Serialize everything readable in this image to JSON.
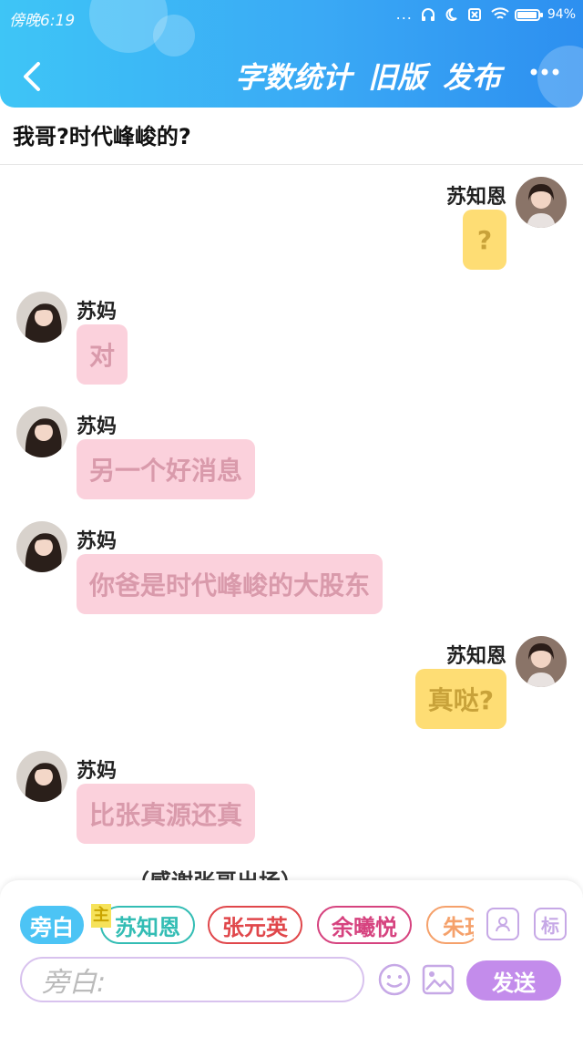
{
  "status_bar": {
    "time": "傍晚6:19",
    "more_dots": "...",
    "battery": "94%"
  },
  "nav": {
    "word_count": "字数统计",
    "old_version": "旧版",
    "publish": "发布",
    "more": "···"
  },
  "chat_title": "我哥?时代峰峻的?",
  "messages": [
    {
      "side": "right",
      "name": "苏知恩",
      "text": "?",
      "color": "yellow"
    },
    {
      "side": "left",
      "name": "苏妈",
      "text": "对",
      "color": "pink"
    },
    {
      "side": "left",
      "name": "苏妈",
      "text": "另一个好消息",
      "color": "pink"
    },
    {
      "side": "left",
      "name": "苏妈",
      "text": "你爸是时代峰峻的大股东",
      "color": "pink"
    },
    {
      "side": "right",
      "name": "苏知恩",
      "text": "真哒?",
      "color": "yellow"
    },
    {
      "side": "left",
      "name": "苏妈",
      "text": "比张真源还真",
      "color": "pink"
    }
  ],
  "narration": "（感谢张哥出场）",
  "composer": {
    "main_tag": "主",
    "roles": [
      {
        "label": "旁白",
        "color": "#4cc4f5",
        "active": true
      },
      {
        "label": "苏知恩",
        "color": "#33bdb4",
        "active": false
      },
      {
        "label": "张元英",
        "color": "#e0474b",
        "active": false
      },
      {
        "label": "余曦悦",
        "color": "#d6437f",
        "active": false
      },
      {
        "label": "朱珏",
        "color": "#f5a16b",
        "active": false
      }
    ],
    "tag_button": "标",
    "input_placeholder": "旁白:",
    "send_label": "发送"
  },
  "colors": {
    "header_start": "#3ec5f6",
    "header_end": "#2d8ff0",
    "pink_bubble": "#fbd1dc",
    "yellow_bubble": "#fedd74",
    "send": "#c38ceb"
  }
}
